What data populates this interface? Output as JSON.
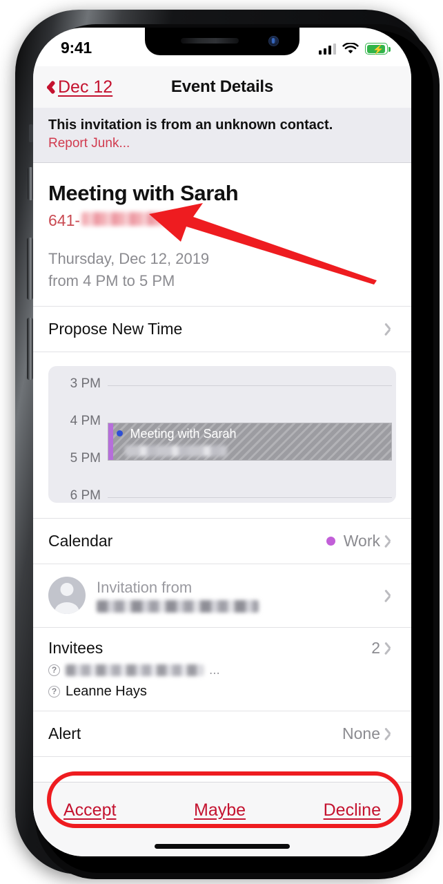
{
  "status_bar": {
    "time": "9:41",
    "signal_icon": "cellular-signal-icon",
    "wifi_icon": "wifi-icon",
    "battery_icon": "battery-charging-icon"
  },
  "nav": {
    "back_label": "Dec 12",
    "back_icon": "chevron-left-icon",
    "title": "Event Details"
  },
  "banner": {
    "message": "This invitation is from an unknown contact.",
    "report_link": "Report Junk..."
  },
  "event": {
    "title": "Meeting with Sarah",
    "phone_prefix": "641-",
    "phone_redacted": true,
    "date_line": "Thursday, Dec 12, 2019",
    "time_line": "from 4 PM to 5 PM"
  },
  "propose": {
    "label": "Propose New Time"
  },
  "chart_data": {
    "type": "timeline",
    "title": "Day timeline preview",
    "ylabel": "",
    "tick_labels": [
      "3 PM",
      "4 PM",
      "5 PM",
      "6 PM"
    ],
    "axis_range": [
      "3 PM",
      "6 PM"
    ],
    "grid": true,
    "events": [
      {
        "name": "Meeting with Sarah",
        "start": "4 PM",
        "end": "5 PM",
        "calendar": "Work",
        "dot_color": "#2e4fd4",
        "edge_color": "#b66edb",
        "fill": "#9c9ca1",
        "pattern": "diagonal-hatch",
        "subtitle_redacted": true
      }
    ]
  },
  "calendar_row": {
    "label": "Calendar",
    "value": "Work",
    "dot_color": "#c25fd8"
  },
  "invitation_row": {
    "label": "Invitation from",
    "sender_redacted": true,
    "avatar_icon": "person-avatar-icon"
  },
  "invitees": {
    "label": "Invitees",
    "count": "2",
    "list": [
      {
        "name": "",
        "redacted": true,
        "ellipsis": "...",
        "status_icon": "question-mark-icon"
      },
      {
        "name": "Leanne Hays",
        "redacted": false,
        "ellipsis": "",
        "status_icon": "question-mark-icon"
      }
    ]
  },
  "alert_row": {
    "label": "Alert",
    "value": "None"
  },
  "actions": {
    "accept": "Accept",
    "maybe": "Maybe",
    "decline": "Decline"
  },
  "annotations": {
    "arrow_color": "#ee1c20",
    "oval_color": "#ee1c20"
  }
}
